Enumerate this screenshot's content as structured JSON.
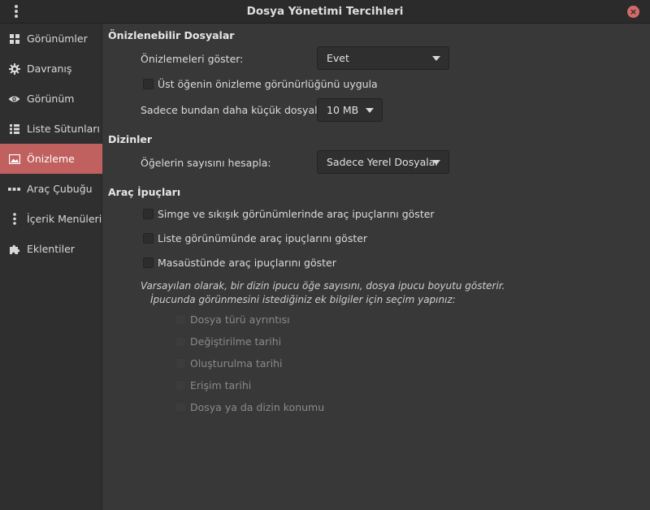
{
  "window": {
    "title": "Dosya Yönetimi Tercihleri"
  },
  "sidebar": {
    "items": [
      {
        "label": "Görünümler",
        "icon": "grid-icon"
      },
      {
        "label": "Davranış",
        "icon": "gear-icon"
      },
      {
        "label": "Görünüm",
        "icon": "eye-icon"
      },
      {
        "label": "Liste Sütunları",
        "icon": "list-icon"
      },
      {
        "label": "Önizleme",
        "icon": "image-icon",
        "active": true
      },
      {
        "label": "Araç Çubuğu",
        "icon": "toolbar-dots-icon"
      },
      {
        "label": "İçerik Menüleri",
        "icon": "vertical-dots-icon"
      },
      {
        "label": "Eklentiler",
        "icon": "puzzle-icon"
      }
    ]
  },
  "previewable": {
    "heading": "Önizlenebilir Dosyalar",
    "show_previews_label": "Önizlemeleri göster:",
    "show_previews_value": "Evet",
    "apply_parent_label": "Üst öğenin önizleme görünürlüğünü uygula",
    "size_limit_label": "Sadece bundan daha küçük dosyalar:",
    "size_limit_value": "10 MB"
  },
  "folders": {
    "heading": "Dizinler",
    "count_items_label": "Öğelerin sayısını hesapla:",
    "count_items_value": "Sadece Yerel Dosyalar"
  },
  "tooltips": {
    "heading": "Araç İpuçları",
    "icon_compact_label": "Simge ve sıkışık görünümlerinde araç ipuçlarını göster",
    "list_view_label": "Liste görünümünde araç ipuçlarını göster",
    "desktop_label": "Masaüstünde araç ipuçlarını göster",
    "hint_line1": "Varsayılan olarak, bir dizin ipucu öğe sayısını, dosya ipucu boyutu gösterir.",
    "hint_line2": "İpucunda görünmesini istediğiniz ek bilgiler için seçim yapınız:",
    "extras": [
      "Dosya türü ayrıntısı",
      "Değiştirilme tarihi",
      "Oluşturulma tarihi",
      "Erişim tarihi",
      "Dosya ya da dizin konumu"
    ]
  },
  "colors": {
    "accent": "#c0605f",
    "background": "#383838",
    "sidebar": "#2f2f2f"
  }
}
